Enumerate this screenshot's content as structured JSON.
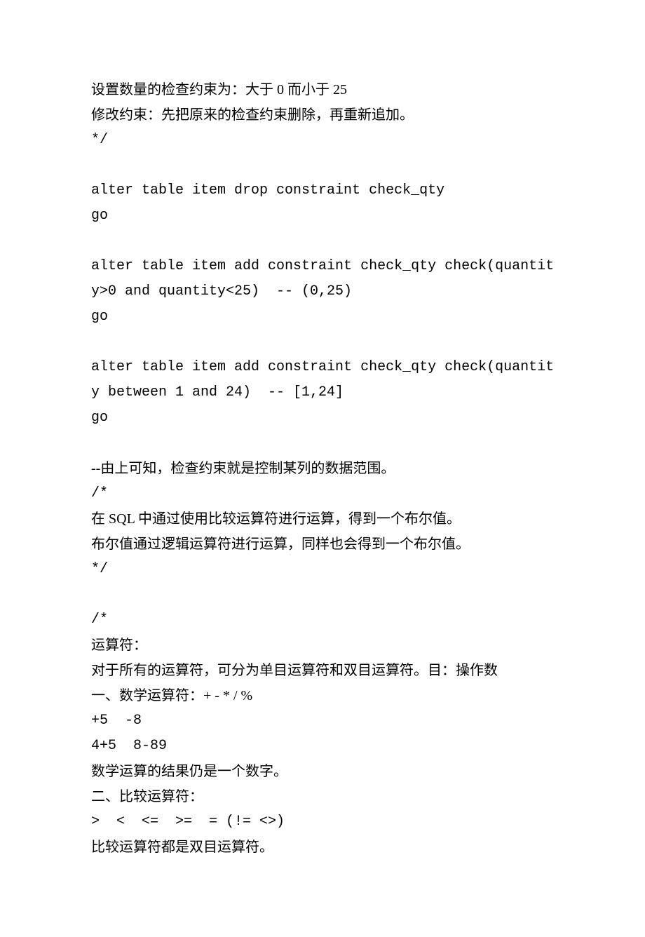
{
  "lines": [
    {
      "text": "设置数量的检查约束为：大于 0 而小于 25",
      "mono": false
    },
    {
      "text": "修改约束：先把原来的检查约束删除，再重新追加。",
      "mono": false
    },
    {
      "text": "*/",
      "mono": true
    },
    {
      "blank": true
    },
    {
      "text": "alter table item drop constraint check_qty",
      "mono": true
    },
    {
      "text": "go",
      "mono": true
    },
    {
      "blank": true
    },
    {
      "text": "alter table item add constraint check_qty check(quantity>0 and quantity<25)  -- (0,25)",
      "mono": true
    },
    {
      "text": "go",
      "mono": true
    },
    {
      "blank": true
    },
    {
      "text": "alter table item add constraint check_qty check(quantity between 1 and 24)  -- [1,24]",
      "mono": true
    },
    {
      "text": "go",
      "mono": true
    },
    {
      "blank": true
    },
    {
      "text": "--由上可知，检查约束就是控制某列的数据范围。",
      "mono": false
    },
    {
      "text": "/*",
      "mono": true
    },
    {
      "text": "在 SQL 中通过使用比较运算符进行运算，得到一个布尔值。",
      "mono": false
    },
    {
      "text": "布尔值通过逻辑运算符进行运算，同样也会得到一个布尔值。",
      "mono": false
    },
    {
      "text": "*/",
      "mono": true
    },
    {
      "blank": true
    },
    {
      "text": "/*",
      "mono": true
    },
    {
      "text": "运算符：",
      "mono": false
    },
    {
      "text": "对于所有的运算符，可分为单目运算符和双目运算符。目：操作数",
      "mono": false
    },
    {
      "text": "一、数学运算符：+ - * / %",
      "mono": false
    },
    {
      "text": "+5  -8",
      "mono": true
    },
    {
      "text": "4+5  8-89",
      "mono": true
    },
    {
      "text": "数学运算的结果仍是一个数字。",
      "mono": false
    },
    {
      "text": "二、比较运算符：",
      "mono": false
    },
    {
      "text": ">  <  <=  >=  = (!= <>)",
      "mono": true
    },
    {
      "text": "比较运算符都是双目运算符。",
      "mono": false
    }
  ]
}
